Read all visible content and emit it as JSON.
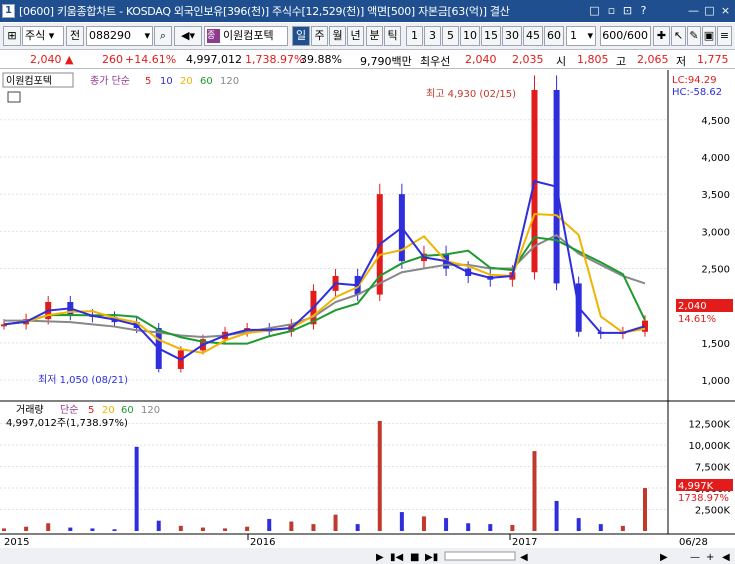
{
  "window": {
    "number": "1",
    "title": "[0600] 키움종합차트 - KOSDAQ 외국인보유[396(천)] 주식수[12,529(천)] 액면[500] 자본금[63(억)] 결산",
    "buttons": [
      "□",
      "▫",
      "⊡",
      "?",
      "—",
      "□",
      "×"
    ]
  },
  "toolbar": {
    "market": "주식",
    "prev": "전",
    "code": "088290",
    "company": "이원컴포텍",
    "period_label": "일",
    "periods": [
      "주",
      "월",
      "년",
      "분",
      "틱"
    ],
    "intervals": [
      "1",
      "3",
      "5",
      "10",
      "15",
      "30",
      "45",
      "60"
    ],
    "interval_value": "1",
    "count": "600",
    "count_total": "/600"
  },
  "quote": {
    "price": "2,040",
    "arrow": "▲",
    "change": "260",
    "change_pct": "+14.61%",
    "volume": "4,997,012",
    "vol_pct": "1,738.97%",
    "turnover": "39.88%",
    "amount": "9,790백만",
    "best_label": "최우선",
    "best1": "2,040",
    "best2": "2,035",
    "open_label": "시",
    "open": "1,805",
    "high_label": "고",
    "high": "2,065",
    "low_label": "저",
    "low": "1,775"
  },
  "chart_data": [
    {
      "type": "line",
      "title": "이원컴포텍",
      "indicator": "종가 단순",
      "ma_periods": [
        "5",
        "10",
        "20",
        "60",
        "120"
      ],
      "colors": {
        "candle": "#e21b1b",
        "ma5": "#e21b1b",
        "ma10": "#2e2edc",
        "ma20": "#f0b400",
        "ma60": "#1e9a2e",
        "ma120": "#888888"
      },
      "x": [
        "2015-01",
        "2015-02",
        "2015-03",
        "2015-04",
        "2015-05",
        "2015-06",
        "2015-07",
        "2015-08",
        "2015-09",
        "2015-10",
        "2015-11",
        "2015-12",
        "2016-01",
        "2016-02",
        "2016-03",
        "2016-04",
        "2016-05",
        "2016-06",
        "2016-07",
        "2016-08",
        "2016-09",
        "2016-10",
        "2016-11",
        "2016-12",
        "2017-01",
        "2017-02",
        "2017-03",
        "2017-04",
        "2017-05",
        "2017-06"
      ],
      "series": [
        {
          "name": "종가",
          "values": [
            1750,
            1820,
            2050,
            1880,
            1850,
            1780,
            1700,
            1150,
            1400,
            1550,
            1650,
            1700,
            1650,
            1750,
            2200,
            2400,
            2150,
            3500,
            2600,
            2700,
            2500,
            2400,
            2350,
            2450,
            4900,
            2300,
            1650,
            1620,
            1650,
            1800
          ]
        },
        {
          "name": "120",
          "values": [
            1800,
            1800,
            1790,
            1780,
            1750,
            1720,
            1670,
            1640,
            1600,
            1580,
            1600,
            1650,
            1700,
            1750,
            1850,
            2050,
            2150,
            2300,
            2450,
            2500,
            2550,
            2550,
            2500,
            2500,
            2800,
            2950,
            2700,
            2550,
            2400,
            2300
          ]
        }
      ],
      "ylim": [
        800,
        4900
      ],
      "yticks": [
        "4,500",
        "4,000",
        "3,500",
        "3,000",
        "2,500",
        "1,500",
        "1,000"
      ],
      "annotations": {
        "high": "최고 4,930 (02/15)",
        "low": "최저 1,050 (08/21)",
        "lc": "LC:94.29",
        "hc": "HC:-58.62",
        "price_tag": "2,040",
        "pct_tag": "14.61%"
      }
    },
    {
      "type": "bar",
      "title": "거래량",
      "indicator": "단순",
      "ma_periods": [
        "5",
        "20",
        "60",
        "120"
      ],
      "value_label": "4,997,012주(1,738.97%)",
      "x": [
        "2015-01",
        "2015-02",
        "2015-03",
        "2015-04",
        "2015-05",
        "2015-06",
        "2015-07",
        "2015-08",
        "2015-09",
        "2015-10",
        "2015-11",
        "2015-12",
        "2016-01",
        "2016-02",
        "2016-03",
        "2016-04",
        "2016-05",
        "2016-06",
        "2016-07",
        "2016-08",
        "2016-09",
        "2016-10",
        "2016-11",
        "2016-12",
        "2017-01",
        "2017-02",
        "2017-03",
        "2017-04",
        "2017-05",
        "2017-06"
      ],
      "values": [
        300,
        500,
        900,
        400,
        300,
        200,
        9800,
        1200,
        600,
        400,
        300,
        500,
        1400,
        1100,
        800,
        1900,
        800,
        12800,
        2200,
        1700,
        1500,
        900,
        800,
        700,
        9300,
        3500,
        1500,
        800,
        600,
        5000
      ],
      "ylim": [
        0,
        13500
      ],
      "yticks": [
        "12,500K",
        "10,000K",
        "7,500K",
        "5,000K",
        "2,500K"
      ],
      "annotations": {
        "vol_tag": "4,997K",
        "vol_pct_tag": "1738.97%"
      }
    }
  ],
  "xaxis": {
    "labels": [
      "2015",
      "2016",
      "2017",
      "06/28"
    ]
  }
}
